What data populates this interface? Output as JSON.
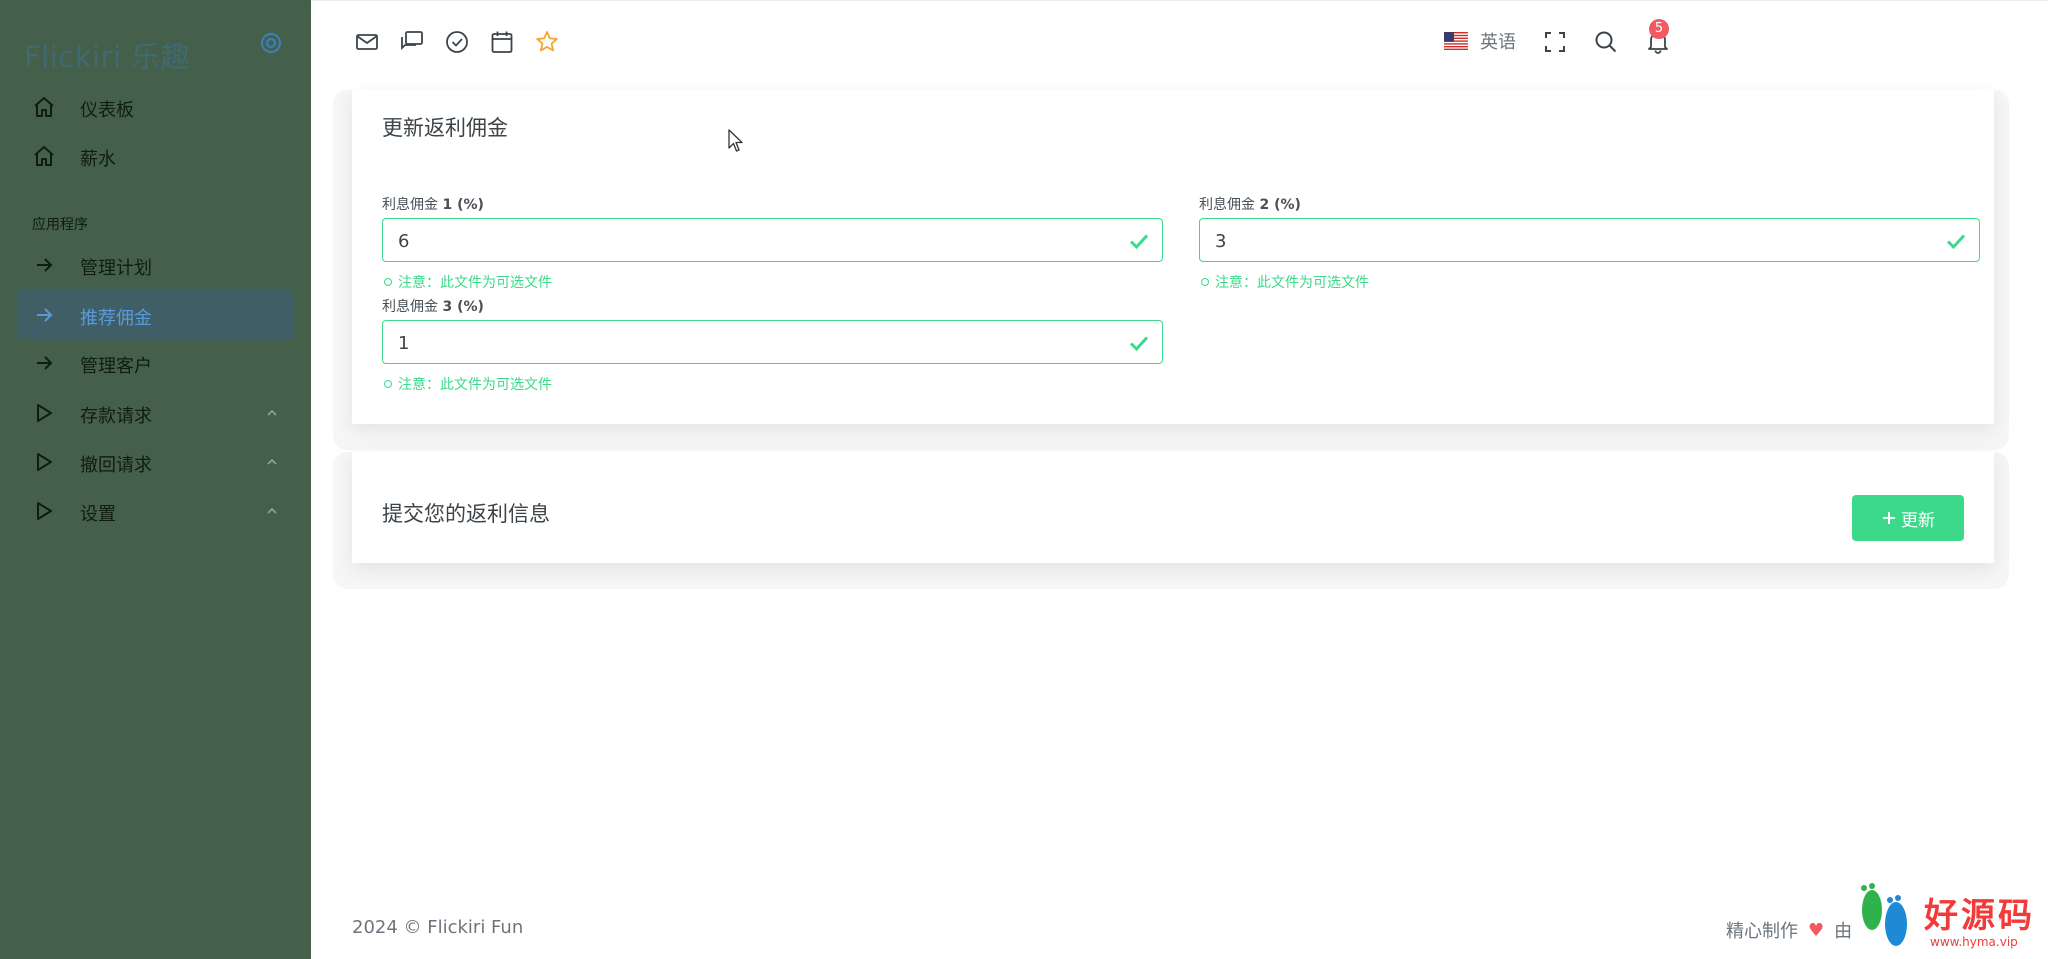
{
  "brand": "Flickiri 乐趣",
  "sidebar": {
    "items": [
      {
        "label": "仪表板"
      },
      {
        "label": "薪水"
      },
      {
        "label": "管理计划"
      },
      {
        "label": "推荐佣金"
      },
      {
        "label": "管理客户"
      },
      {
        "label": "存款请求"
      },
      {
        "label": "撤回请求"
      },
      {
        "label": "设置"
      }
    ],
    "section": "应用程序"
  },
  "topbar": {
    "language": "英语",
    "notifications": "5"
  },
  "card1": {
    "title": "更新返利佣金",
    "fields": [
      {
        "label_prefix": "利息佣金 ",
        "label_bold": "1 (%)",
        "value": "6",
        "note": "注意：此文件为可选文件"
      },
      {
        "label_prefix": "利息佣金 ",
        "label_bold": "2 (%)",
        "value": "3",
        "note": "注意：此文件为可选文件"
      },
      {
        "label_prefix": "利息佣金 ",
        "label_bold": "3 (%)",
        "value": "1",
        "note": "注意：此文件为可选文件"
      }
    ]
  },
  "card2": {
    "title": "提交您的返利信息",
    "button": "更新"
  },
  "footer": {
    "copyright": "2024 © Flickiri Fun",
    "made_with": "精心制作",
    "by": "由"
  },
  "watermark": {
    "text": "好源码",
    "url": "www.hyma.vip"
  },
  "colors": {
    "sidebar_bg": "#45604a",
    "accent": "#3cd98b",
    "active_bg": "#3f5e66",
    "badge": "#f25961"
  }
}
